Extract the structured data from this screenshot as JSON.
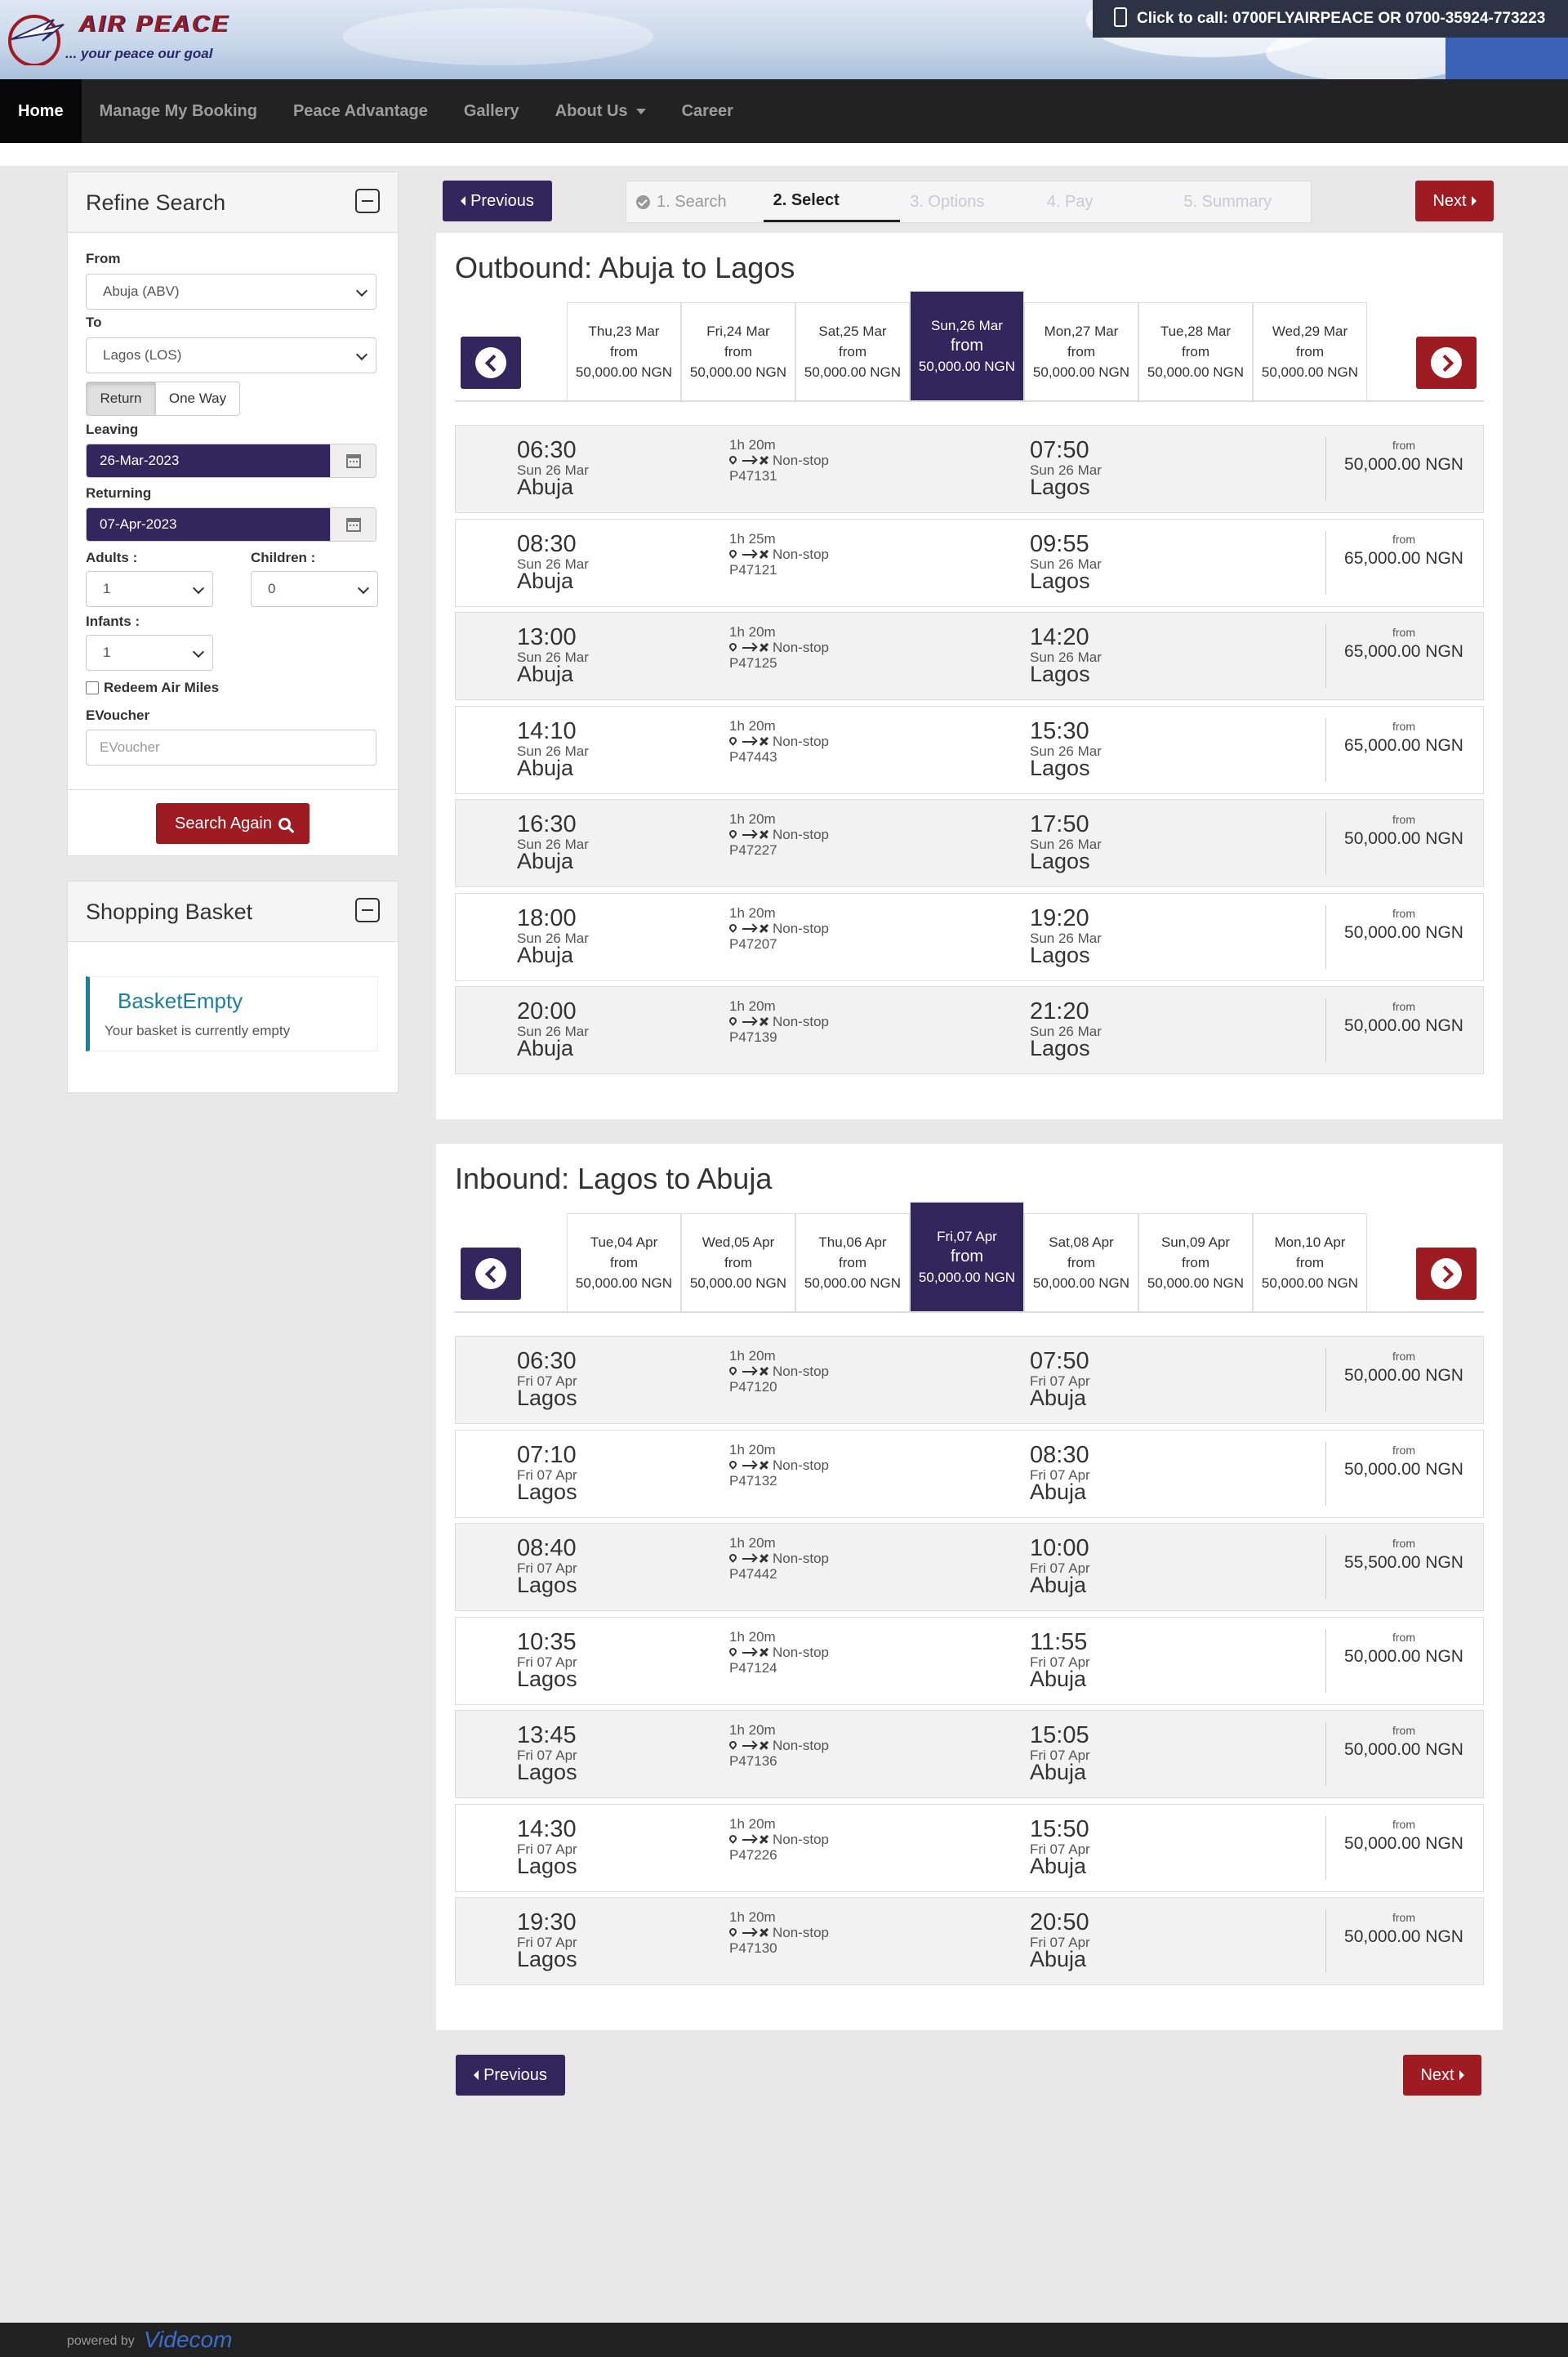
{
  "header": {
    "brand": "AIR PEACE",
    "tagline": "... your peace our goal",
    "call": "Click to call: 0700FLYAIRPEACE OR 0700-35924-773223"
  },
  "nav": [
    "Home",
    "Manage My Booking",
    "Peace Advantage",
    "Gallery",
    "About Us",
    "Career"
  ],
  "refine": {
    "title": "Refine Search",
    "from_label": "From",
    "from_value": "Abuja (ABV)",
    "to_label": "To",
    "to_value": "Lagos (LOS)",
    "return_label": "Return",
    "oneway_label": "One Way",
    "leaving_label": "Leaving",
    "leaving_value": "26-Mar-2023",
    "returning_label": "Returning",
    "returning_value": "07-Apr-2023",
    "adults_label": "Adults :",
    "adults_value": "1",
    "children_label": "Children :",
    "children_value": "0",
    "infants_label": "Infants :",
    "infants_value": "1",
    "redeem_label": "Redeem Air Miles",
    "evoucher_label": "EVoucher",
    "evoucher_placeholder": "EVoucher",
    "search_again": "Search Again"
  },
  "basket": {
    "title": "Shopping Basket",
    "status": "BasketEmpty",
    "message": "Your basket is currently empty"
  },
  "steps": [
    "1. Search",
    "2. Select",
    "3. Options",
    "4. Pay",
    "5. Summary"
  ],
  "buttons": {
    "previous": "Previous",
    "next": "Next"
  },
  "outbound": {
    "title": "Outbound: Abuja to Lagos",
    "dates": [
      {
        "day": "Thu,23 Mar",
        "from": "from",
        "price": "50,000.00 NGN"
      },
      {
        "day": "Fri,24 Mar",
        "from": "from",
        "price": "50,000.00 NGN"
      },
      {
        "day": "Sat,25 Mar",
        "from": "from",
        "price": "50,000.00 NGN"
      },
      {
        "day": "Sun,26 Mar",
        "from": "from",
        "price": "50,000.00 NGN"
      },
      {
        "day": "Mon,27 Mar",
        "from": "from",
        "price": "50,000.00 NGN"
      },
      {
        "day": "Tue,28 Mar",
        "from": "from",
        "price": "50,000.00 NGN"
      },
      {
        "day": "Wed,29 Mar",
        "from": "from",
        "price": "50,000.00 NGN"
      }
    ],
    "flights": [
      {
        "dep": "06:30",
        "dep_date": "Sun 26 Mar",
        "dep_city": "Abuja",
        "duration": "1h 20m",
        "stops": "Non-stop",
        "flight": "P47131",
        "arr": "07:50",
        "arr_date": "Sun 26 Mar",
        "arr_city": "Lagos",
        "from": "from",
        "price": "50,000.00 NGN"
      },
      {
        "dep": "08:30",
        "dep_date": "Sun 26 Mar",
        "dep_city": "Abuja",
        "duration": "1h 25m",
        "stops": "Non-stop",
        "flight": "P47121",
        "arr": "09:55",
        "arr_date": "Sun 26 Mar",
        "arr_city": "Lagos",
        "from": "from",
        "price": "65,000.00 NGN"
      },
      {
        "dep": "13:00",
        "dep_date": "Sun 26 Mar",
        "dep_city": "Abuja",
        "duration": "1h 20m",
        "stops": "Non-stop",
        "flight": "P47125",
        "arr": "14:20",
        "arr_date": "Sun 26 Mar",
        "arr_city": "Lagos",
        "from": "from",
        "price": "65,000.00 NGN"
      },
      {
        "dep": "14:10",
        "dep_date": "Sun 26 Mar",
        "dep_city": "Abuja",
        "duration": "1h 20m",
        "stops": "Non-stop",
        "flight": "P47443",
        "arr": "15:30",
        "arr_date": "Sun 26 Mar",
        "arr_city": "Lagos",
        "from": "from",
        "price": "65,000.00 NGN"
      },
      {
        "dep": "16:30",
        "dep_date": "Sun 26 Mar",
        "dep_city": "Abuja",
        "duration": "1h 20m",
        "stops": "Non-stop",
        "flight": "P47227",
        "arr": "17:50",
        "arr_date": "Sun 26 Mar",
        "arr_city": "Lagos",
        "from": "from",
        "price": "50,000.00 NGN"
      },
      {
        "dep": "18:00",
        "dep_date": "Sun 26 Mar",
        "dep_city": "Abuja",
        "duration": "1h 20m",
        "stops": "Non-stop",
        "flight": "P47207",
        "arr": "19:20",
        "arr_date": "Sun 26 Mar",
        "arr_city": "Lagos",
        "from": "from",
        "price": "50,000.00 NGN"
      },
      {
        "dep": "20:00",
        "dep_date": "Sun 26 Mar",
        "dep_city": "Abuja",
        "duration": "1h 20m",
        "stops": "Non-stop",
        "flight": "P47139",
        "arr": "21:20",
        "arr_date": "Sun 26 Mar",
        "arr_city": "Lagos",
        "from": "from",
        "price": "50,000.00 NGN"
      }
    ]
  },
  "inbound": {
    "title": "Inbound: Lagos to Abuja",
    "dates": [
      {
        "day": "Tue,04 Apr",
        "from": "from",
        "price": "50,000.00 NGN"
      },
      {
        "day": "Wed,05 Apr",
        "from": "from",
        "price": "50,000.00 NGN"
      },
      {
        "day": "Thu,06 Apr",
        "from": "from",
        "price": "50,000.00 NGN"
      },
      {
        "day": "Fri,07 Apr",
        "from": "from",
        "price": "50,000.00 NGN"
      },
      {
        "day": "Sat,08 Apr",
        "from": "from",
        "price": "50,000.00 NGN"
      },
      {
        "day": "Sun,09 Apr",
        "from": "from",
        "price": "50,000.00 NGN"
      },
      {
        "day": "Mon,10 Apr",
        "from": "from",
        "price": "50,000.00 NGN"
      }
    ],
    "flights": [
      {
        "dep": "06:30",
        "dep_date": "Fri 07 Apr",
        "dep_city": "Lagos",
        "duration": "1h 20m",
        "stops": "Non-stop",
        "flight": "P47120",
        "arr": "07:50",
        "arr_date": "Fri 07 Apr",
        "arr_city": "Abuja",
        "from": "from",
        "price": "50,000.00 NGN"
      },
      {
        "dep": "07:10",
        "dep_date": "Fri 07 Apr",
        "dep_city": "Lagos",
        "duration": "1h 20m",
        "stops": "Non-stop",
        "flight": "P47132",
        "arr": "08:30",
        "arr_date": "Fri 07 Apr",
        "arr_city": "Abuja",
        "from": "from",
        "price": "50,000.00 NGN"
      },
      {
        "dep": "08:40",
        "dep_date": "Fri 07 Apr",
        "dep_city": "Lagos",
        "duration": "1h 20m",
        "stops": "Non-stop",
        "flight": "P47442",
        "arr": "10:00",
        "arr_date": "Fri 07 Apr",
        "arr_city": "Abuja",
        "from": "from",
        "price": "55,500.00 NGN"
      },
      {
        "dep": "10:35",
        "dep_date": "Fri 07 Apr",
        "dep_city": "Lagos",
        "duration": "1h 20m",
        "stops": "Non-stop",
        "flight": "P47124",
        "arr": "11:55",
        "arr_date": "Fri 07 Apr",
        "arr_city": "Abuja",
        "from": "from",
        "price": "50,000.00 NGN"
      },
      {
        "dep": "13:45",
        "dep_date": "Fri 07 Apr",
        "dep_city": "Lagos",
        "duration": "1h 20m",
        "stops": "Non-stop",
        "flight": "P47136",
        "arr": "15:05",
        "arr_date": "Fri 07 Apr",
        "arr_city": "Abuja",
        "from": "from",
        "price": "50,000.00 NGN"
      },
      {
        "dep": "14:30",
        "dep_date": "Fri 07 Apr",
        "dep_city": "Lagos",
        "duration": "1h 20m",
        "stops": "Non-stop",
        "flight": "P47226",
        "arr": "15:50",
        "arr_date": "Fri 07 Apr",
        "arr_city": "Abuja",
        "from": "from",
        "price": "50,000.00 NGN"
      },
      {
        "dep": "19:30",
        "dep_date": "Fri 07 Apr",
        "dep_city": "Lagos",
        "duration": "1h 20m",
        "stops": "Non-stop",
        "flight": "P47130",
        "arr": "20:50",
        "arr_date": "Fri 07 Apr",
        "arr_city": "Abuja",
        "from": "from",
        "price": "50,000.00 NGN"
      }
    ]
  },
  "footer": {
    "powered": "powered by",
    "vendor": "Videcom"
  }
}
